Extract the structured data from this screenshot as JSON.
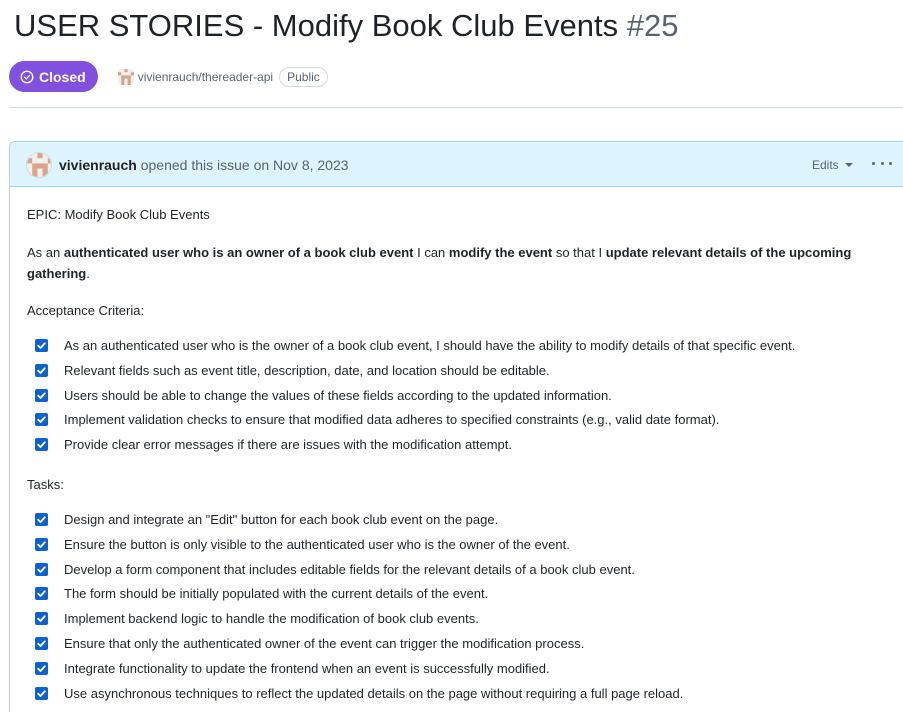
{
  "issue": {
    "title": "USER STORIES - Modify Book Club Events",
    "number": "#25",
    "state": "Closed",
    "repo": "vivienrauch/thereader-api",
    "visibility": "Public"
  },
  "comment": {
    "author": "vivienrauch",
    "action": "opened this issue on Nov 8, 2023",
    "edits_label": "Edits"
  },
  "body": {
    "epic": "EPIC: Modify Book Club Events",
    "story": {
      "p1": "As an ",
      "b1": "authenticated user who is an owner of a book club event",
      "p2": " I can ",
      "b2": "modify the event",
      "p3": " so that I ",
      "b3": "update relevant details of the upcoming gathering",
      "p4": "."
    },
    "criteria_heading": "Acceptance Criteria:",
    "criteria": [
      {
        "text": "As an authenticated user who is the owner of a book club event, I should have the ability to modify details of that specific event.",
        "checked": true
      },
      {
        "text": "Relevant fields such as event title, description, date, and location should be editable.",
        "checked": true
      },
      {
        "text": "Users should be able to change the values of these fields according to the updated information.",
        "checked": true
      },
      {
        "text": "Implement validation checks to ensure that modified data adheres to specified constraints (e.g., valid date format).",
        "checked": true
      },
      {
        "text": "Provide clear error messages if there are issues with the modification attempt.",
        "checked": true
      }
    ],
    "tasks_heading": "Tasks:",
    "tasks": [
      {
        "text": "Design and integrate an \"Edit\" button for each book club event on the page.",
        "checked": true
      },
      {
        "text": "Ensure the button is only visible to the authenticated user who is the owner of the event.",
        "checked": true
      },
      {
        "text": "Develop a form component that includes editable fields for the relevant details of a book club event.",
        "checked": true
      },
      {
        "text": "The form should be initially populated with the current details of the event.",
        "checked": true
      },
      {
        "text": "Implement backend logic to handle the modification of book club events.",
        "checked": true
      },
      {
        "text": "Ensure that only the authenticated owner of the event can trigger the modification process.",
        "checked": true
      },
      {
        "text": "Integrate functionality to update the frontend when an event is successfully modified.",
        "checked": true
      },
      {
        "text": "Use asynchronous techniques to reflect the updated details on the page without requiring a full page reload.",
        "checked": true
      }
    ]
  },
  "colors": {
    "closed_badge": "#8250df",
    "header_bg": "#ddf4ff",
    "header_border": "#9cd7f7",
    "checkbox": "#0b63d1"
  },
  "icons": {
    "state": "check-circle-icon",
    "repo_avatar": "identicon-avatar",
    "author_avatar": "identicon-avatar",
    "menu": "kebab-horizontal-icon",
    "edits_caret": "triangle-down-icon"
  }
}
